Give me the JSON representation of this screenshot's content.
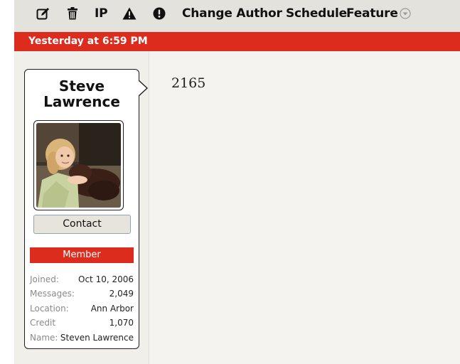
{
  "toolbar": {
    "edit_icon": "edit-icon",
    "delete_icon": "trash-icon",
    "ip_label": "IP",
    "report_icon": "warning-icon",
    "warn_icon": "exclamation-icon",
    "change_author_label": "Change Author",
    "schedule_label": "Schedule",
    "feature_label": "Feature",
    "feature_dropdown_icon": "chevron-down-circle-icon"
  },
  "post": {
    "date": "Yesterday at 6:59 PM",
    "body": "2165"
  },
  "user": {
    "name": "Steve Lawrence",
    "avatar": "avatar-photo",
    "contact_label": "Contact",
    "role": "Member",
    "info": [
      {
        "key": "Joined:",
        "value": "Oct 10, 2006"
      },
      {
        "key": "Messages:",
        "value": "2,049"
      },
      {
        "key": "Location:",
        "value": "Ann Arbor"
      },
      {
        "key": "Credit",
        "value": "1,070"
      },
      {
        "key": "Name:",
        "value": "Steven Lawrence"
      }
    ]
  },
  "colors": {
    "accent_red": "#db2c1d",
    "toolbar_bg": "#e3e2dc",
    "sidebar_bg": "#f0efea",
    "content_bg": "#f4f3ef"
  }
}
